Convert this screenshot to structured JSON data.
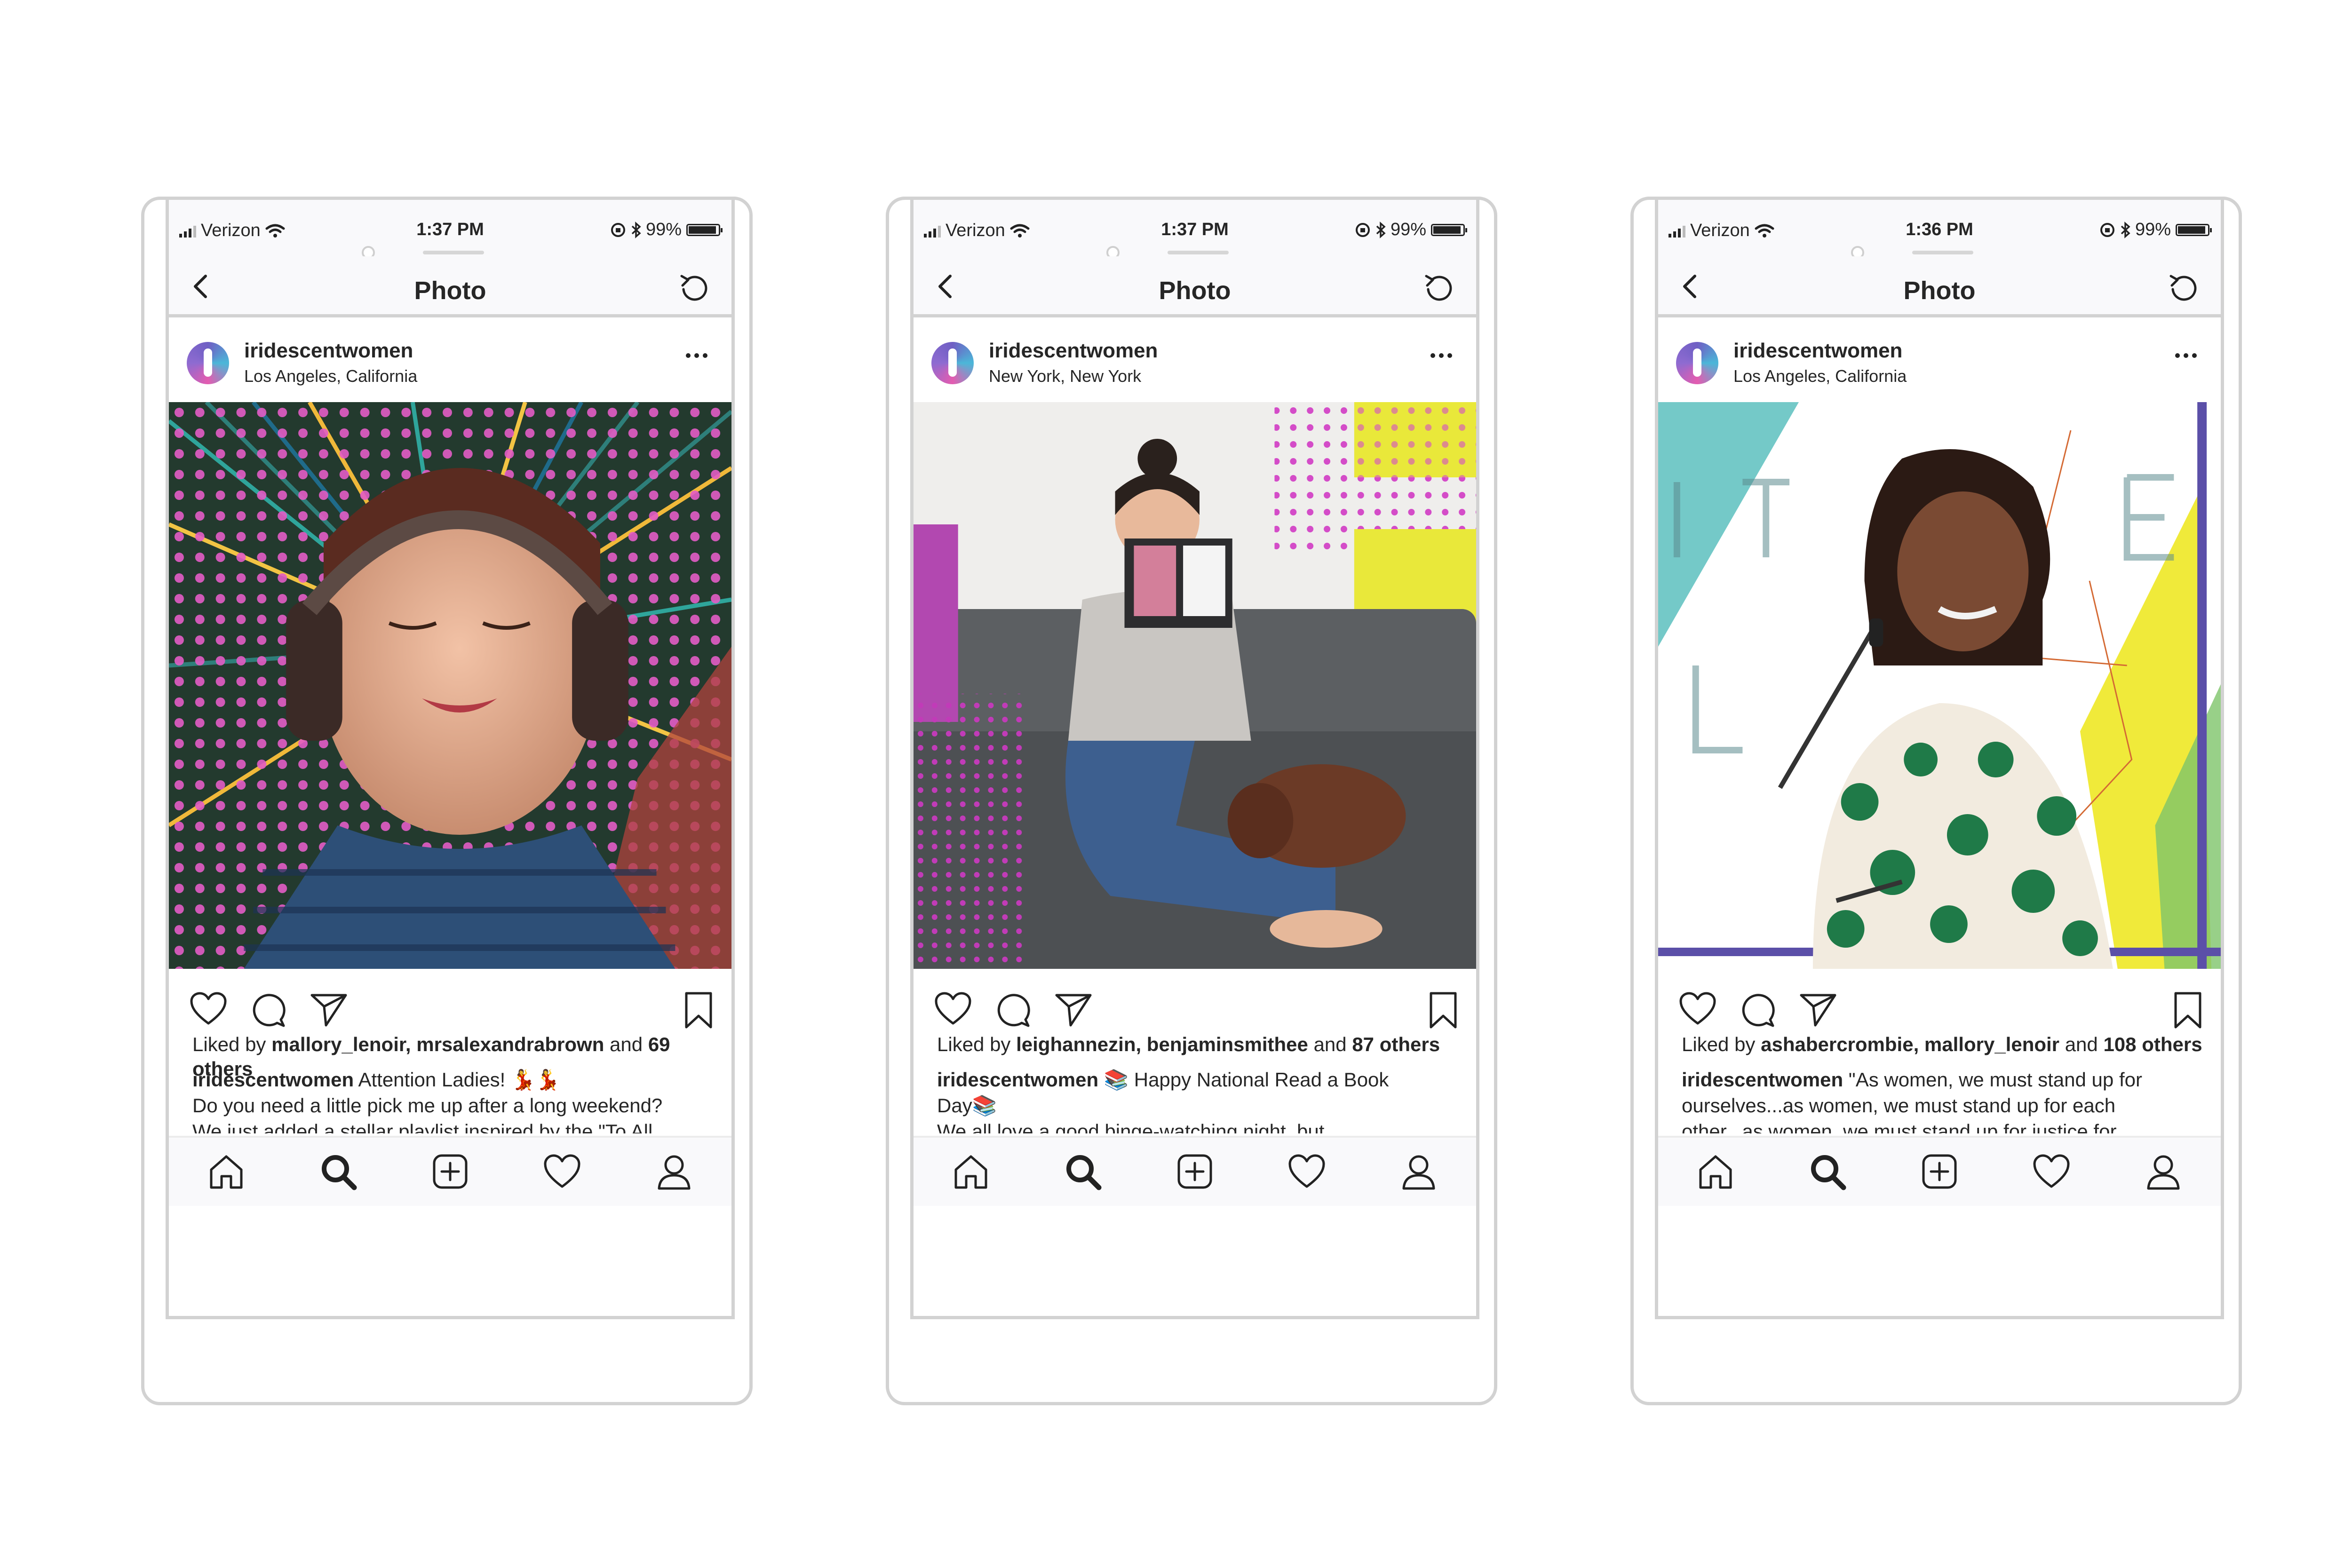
{
  "nav": {
    "title": "Photo"
  },
  "phones": [
    {
      "status": {
        "carrier": "Verizon",
        "time": "1:37 PM",
        "battery": "99%"
      },
      "username": "iridescentwomen",
      "location": "Los Angeles, California",
      "likes": {
        "prefix": "Liked by ",
        "users": "mallory_lenoir, mrsalexandrabrown",
        "mid": " and ",
        "count": "69",
        "suffix": " others"
      },
      "caption": {
        "user": "iridescentwomen",
        "text": " Attention Ladies! 💃💃",
        "line2": "Do you need a little pick me up after a long weekend?",
        "line3": "We just added a stellar playlist inspired by the \"To All"
      },
      "photo_theme": "headphones"
    },
    {
      "status": {
        "carrier": "Verizon",
        "time": "1:37 PM",
        "battery": "99%"
      },
      "username": "iridescentwomen",
      "location": "New York, New York",
      "likes": {
        "prefix": "Liked by ",
        "users": "leighannezin, benjaminsmithee",
        "mid": " and ",
        "count": "87",
        "suffix": " others"
      },
      "caption": {
        "user": "iridescentwomen",
        "text": " 📚 Happy National Read a Book",
        "line2": "Day📚",
        "line3": "We all love a good binge-watching night, but"
      },
      "photo_theme": "reading"
    },
    {
      "status": {
        "carrier": "Verizon",
        "time": "1:36 PM",
        "battery": "99%"
      },
      "username": "iridescentwomen",
      "location": "Los Angeles, California",
      "likes": {
        "prefix": "Liked by ",
        "users": "ashabercrombie, mallory_lenoir",
        "mid": " and ",
        "count": "108",
        "suffix": " others"
      },
      "caption": {
        "user": "iridescentwomen",
        "text": " \"As women, we must stand up for",
        "line2": "ourselves...as women, we must stand up for each",
        "line3": "other...as women, we must stand up for justice for"
      },
      "photo_theme": "speaker"
    }
  ],
  "icons": {
    "back": "chevron-left-icon",
    "refresh": "refresh-icon",
    "more": "more-icon",
    "like": "heart-icon",
    "comment": "comment-icon",
    "share": "send-icon",
    "save": "bookmark-icon",
    "tabs": [
      "home-icon",
      "search-icon",
      "add-post-icon",
      "activity-heart-icon",
      "profile-icon"
    ]
  },
  "colors": {
    "frame": "#d2d2d2",
    "bar": "#f9f9fb",
    "text": "#262626"
  }
}
